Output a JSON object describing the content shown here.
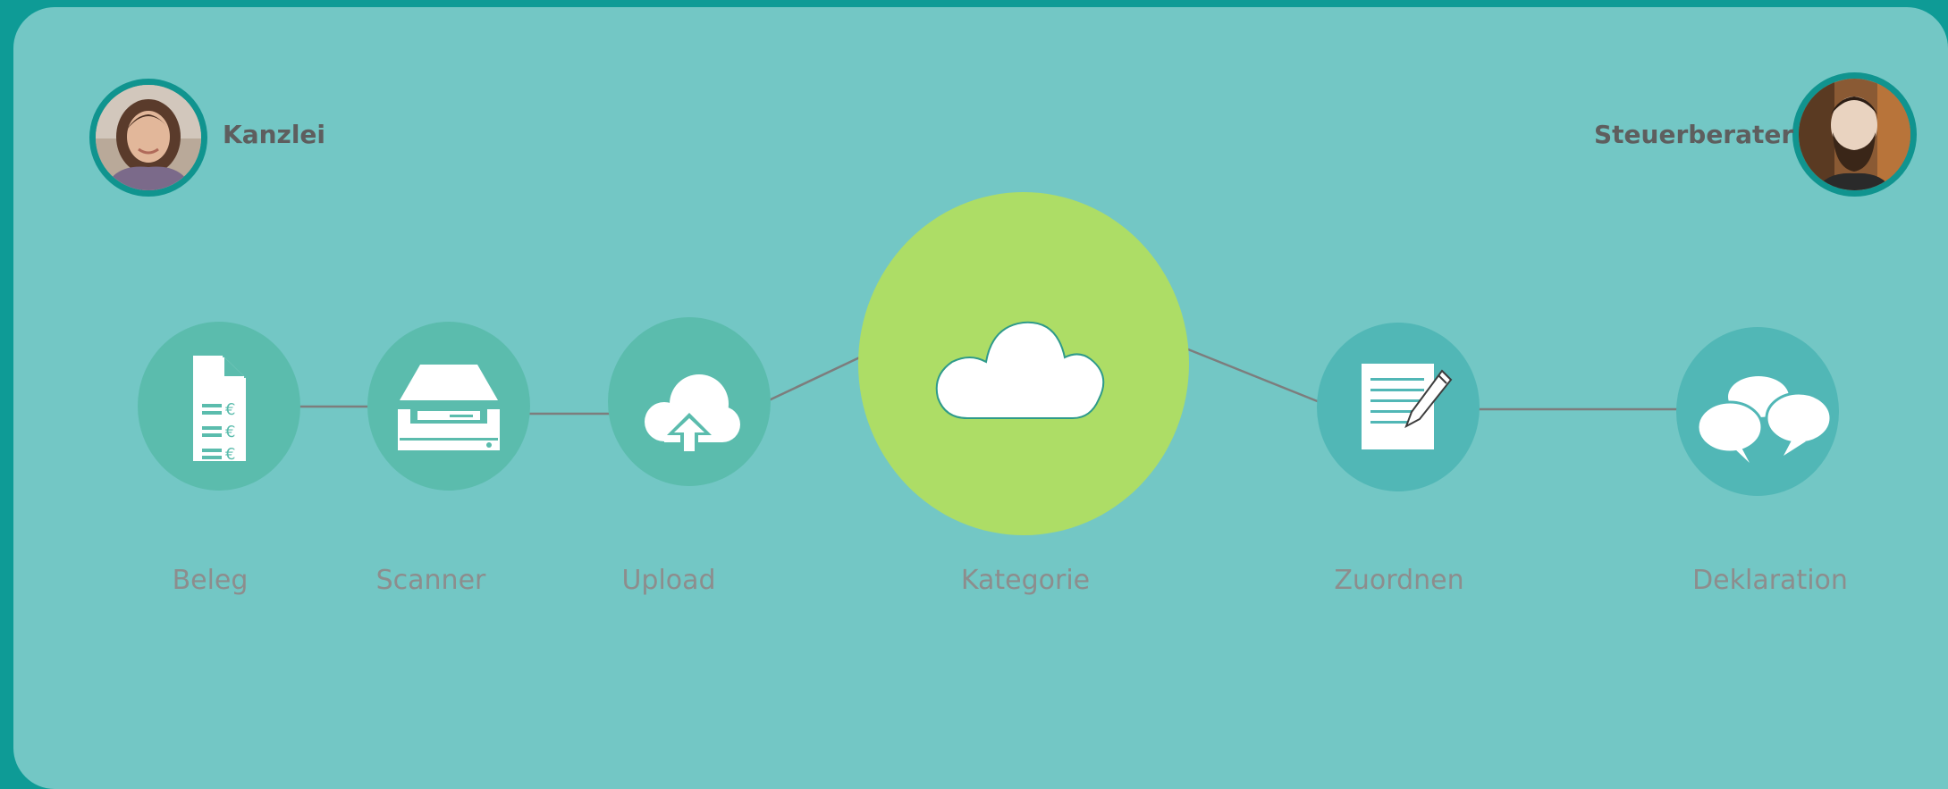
{
  "people": {
    "left": {
      "label": "Kanzlei",
      "avatar_icon": "woman-portrait-avatar"
    },
    "right": {
      "label": "Steuerberater",
      "avatar_icon": "bearded-man-portrait-avatar"
    }
  },
  "steps": [
    {
      "label": "Beleg",
      "icon": "receipt-euro-icon",
      "color": "#5bbcad"
    },
    {
      "label": "Scanner",
      "icon": "scanner-icon",
      "color": "#5bbcad"
    },
    {
      "label": "Upload",
      "icon": "cloud-upload-icon",
      "color": "#5bbcad"
    },
    {
      "label": "Kategorie",
      "icon": "cloud-icon",
      "color": "#addd66"
    },
    {
      "label": "Zuordnen",
      "icon": "document-pen-icon",
      "color": "#51b7b6"
    },
    {
      "label": "Deklaration",
      "icon": "speech-bubbles-icon",
      "color": "#51b7b6"
    }
  ],
  "colors": {
    "frame": "#0e9b96",
    "panel": "#73c7c5",
    "connector": "#7d7d7d",
    "label": "#8d8d8d",
    "person_label": "#5e5e5e"
  }
}
